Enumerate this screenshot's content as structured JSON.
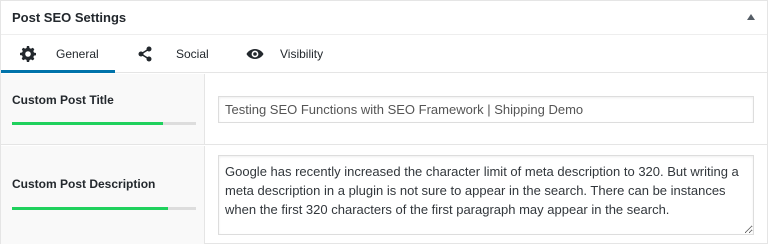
{
  "metabox": {
    "title": "Post SEO Settings"
  },
  "tabs": [
    {
      "label": "General",
      "icon": "gear-icon",
      "active": true
    },
    {
      "label": "Social",
      "icon": "share-icon",
      "active": false
    },
    {
      "label": "Visibility",
      "icon": "eye-icon",
      "active": false
    }
  ],
  "fields": {
    "title": {
      "label": "Custom Post Title",
      "value": "Testing SEO Functions with SEO Framework | Shipping Demo",
      "counter_fraction": 0.82
    },
    "description": {
      "label": "Custom Post Description",
      "value": "Google has recently increased the character limit of meta description to 320. But writing a meta description in a plugin is not sure to appear in the search. There can be instances when the first 320 characters of the first paragraph may appear in the search.",
      "counter_fraction": 0.85
    }
  },
  "colors": {
    "accent": "#0073aa",
    "counter_good": "#1fd15d"
  }
}
